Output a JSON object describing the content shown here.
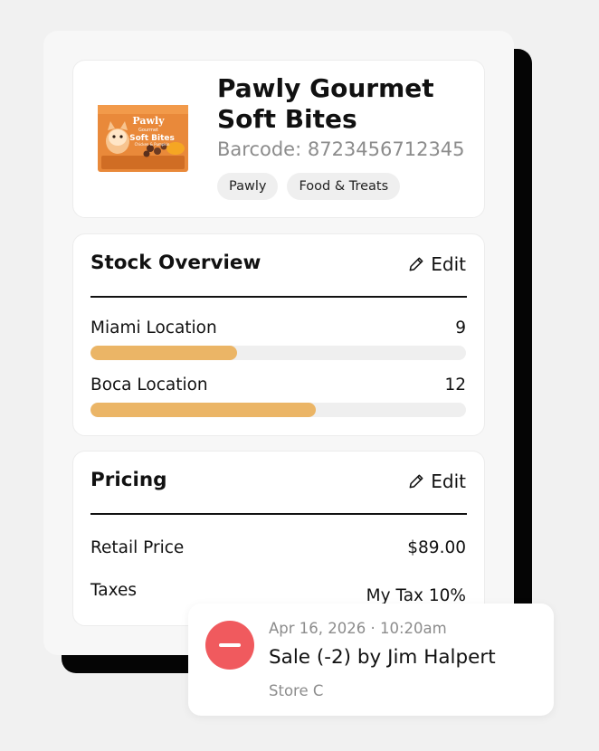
{
  "product": {
    "name": "Pawly Gourmet Soft Bites",
    "barcode": "Barcode: 8723456712345",
    "tags": [
      "Pawly",
      "Food & Treats"
    ],
    "package": {
      "brand": "Pawly",
      "sub": "Gourmet",
      "title": "Soft Bites",
      "flavor": "Chicken & Pumpkin",
      "color": "#e9893a"
    }
  },
  "stock": {
    "title": "Stock Overview",
    "edit_label": "Edit",
    "locations": [
      {
        "name": "Miami Location",
        "qty": "9",
        "fill_percent": 39
      },
      {
        "name": "Boca Location",
        "qty": "12",
        "fill_percent": 60
      }
    ]
  },
  "pricing": {
    "title": "Pricing",
    "edit_label": "Edit",
    "rows": [
      {
        "label": "Retail Price",
        "value": "$89.00"
      },
      {
        "label": "Taxes",
        "value": "My Tax 10%"
      }
    ]
  },
  "toast": {
    "timestamp": "Apr 16, 2026 · 10:20am",
    "title": "Sale (-2) by Jim Halpert",
    "store": "Store C",
    "icon": "minus-circle-icon",
    "icon_color": "#f05a5e"
  },
  "colors": {
    "bar_fill": "#ebb566",
    "bar_track": "#efefef",
    "muted_text": "#8c8c8c"
  }
}
